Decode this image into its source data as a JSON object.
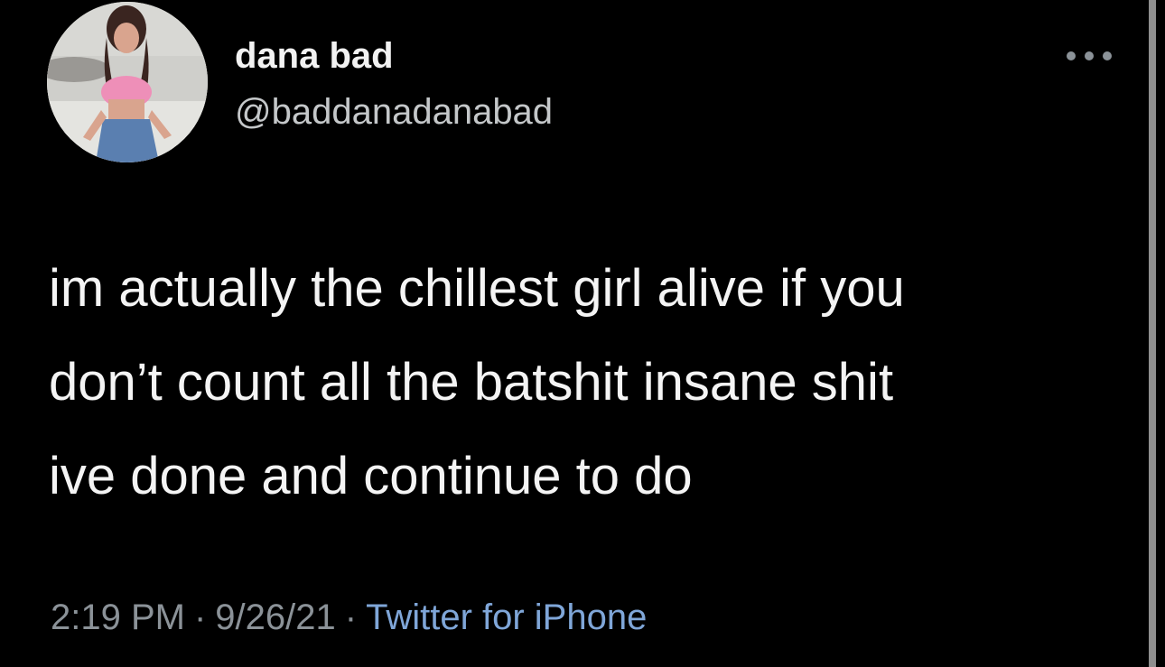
{
  "author": {
    "display_name": "dana bad",
    "handle": "@baddanadanabad"
  },
  "tweet": {
    "lines": [
      "im actually the chillest girl alive if you",
      "don’t count all the batshit insane shit",
      "ive done and continue to do"
    ]
  },
  "meta": {
    "time": "2:19 PM",
    "separator": "·",
    "date": "9/26/21",
    "source": "Twitter for iPhone"
  },
  "icons": {
    "more": "more-horizontal-icon"
  },
  "colors": {
    "background": "#000000",
    "text": "#f4f4f4",
    "secondary_text": "#8b9298",
    "link": "#7fa6d8"
  }
}
